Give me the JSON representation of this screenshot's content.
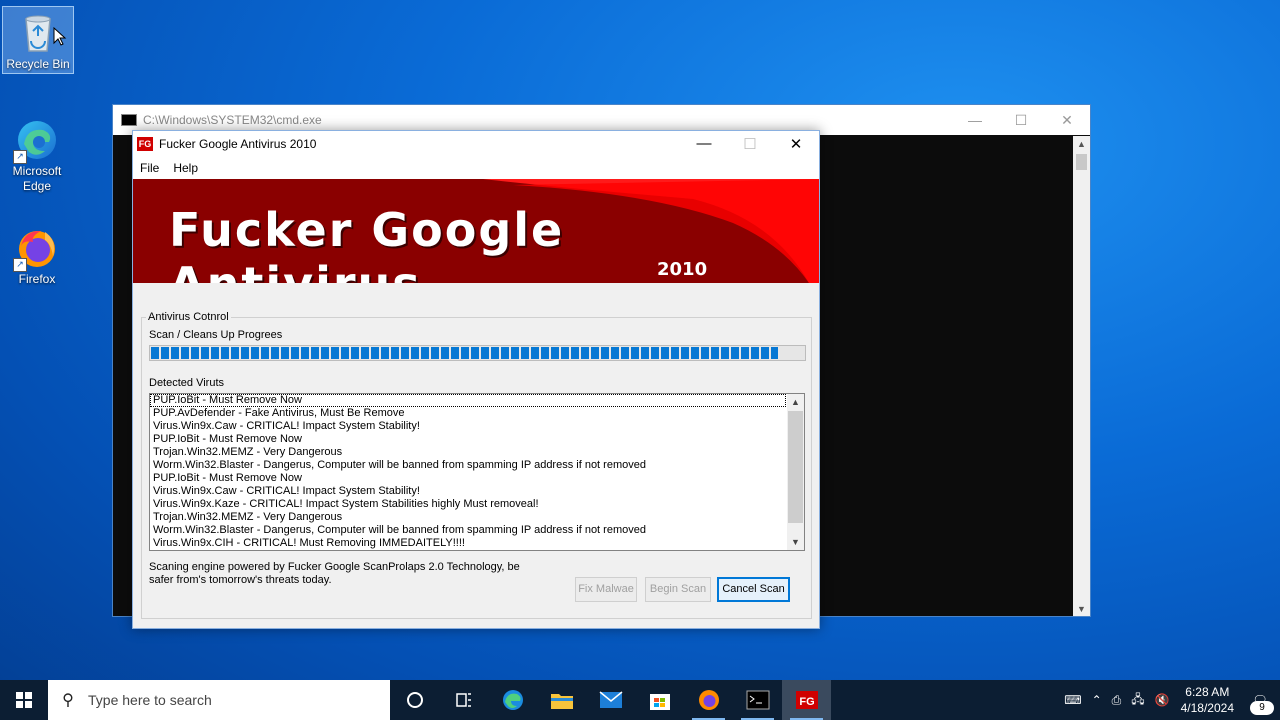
{
  "desktop": {
    "icons": [
      {
        "label": "Recycle Bin"
      },
      {
        "label": "Microsoft Edge"
      },
      {
        "label": "Firefox"
      }
    ]
  },
  "cmd_window": {
    "title": "C:\\Windows\\SYSTEM32\\cmd.exe",
    "controls": {
      "minimize": "—",
      "maximize": "☐",
      "close": "✕"
    }
  },
  "av_window": {
    "title": "Fucker Google Antivirus 2010",
    "logo_text": "FG",
    "menu": [
      "File",
      "Help"
    ],
    "banner": {
      "title": "Fucker Google Antivirus",
      "year": "2010"
    },
    "group_label": "Antivirus Cotnrol",
    "progress_label": "Scan / Cleans Up Progrees",
    "progress_value": 0.96,
    "detected_label": "Detected Viruts",
    "detected": [
      "PUP.IoBit - Must Remove Now",
      "PUP.AvDefender - Fake Antivirus, Must Be Remove",
      "Virus.Win9x.Caw - CRITICAL! Impact System Stability!",
      "PUP.IoBit - Must Remove Now",
      "Trojan.Win32.MEMZ - Very Dangerous",
      "Worm.Win32.Blaster - Dangerus, Computer will be banned from spamming IP address if not removed",
      "PUP.IoBit - Must Remove Now",
      "Virus.Win9x.Caw - CRITICAL! Impact System Stability!",
      "Virus.Win9x.Kaze - CRITICAL! Impact System Stabilities highly Must removeal!",
      "Trojan.Win32.MEMZ - Very Dangerous",
      "Worm.Win32.Blaster - Dangerus, Computer will be banned from spamming IP address if not removed",
      "Virus.Win9x.CIH - CRITICAL! Must Removing IMMEDAITELY!!!!"
    ],
    "footer": "Scaning engine powered by Fucker Google ScanProlaps 2.0 Technology, be safer from's tomorrow's threats today.",
    "buttons": {
      "fix": "Fix Malwae",
      "begin": "Begin Scan",
      "cancel": "Cancel Scan"
    }
  },
  "taskbar": {
    "search_placeholder": "Type here to search",
    "time": "6:28 AM",
    "date": "4/18/2024",
    "notification_count": "9",
    "pinned": [
      "Task View",
      "Microsoft Edge",
      "File Explorer",
      "Mail",
      "Microsoft Store",
      "Firefox",
      "Command Prompt",
      "Fucker Google Antivirus"
    ],
    "colors": {
      "taskbar": "#0c1e33",
      "accent": "#0678d4"
    }
  }
}
